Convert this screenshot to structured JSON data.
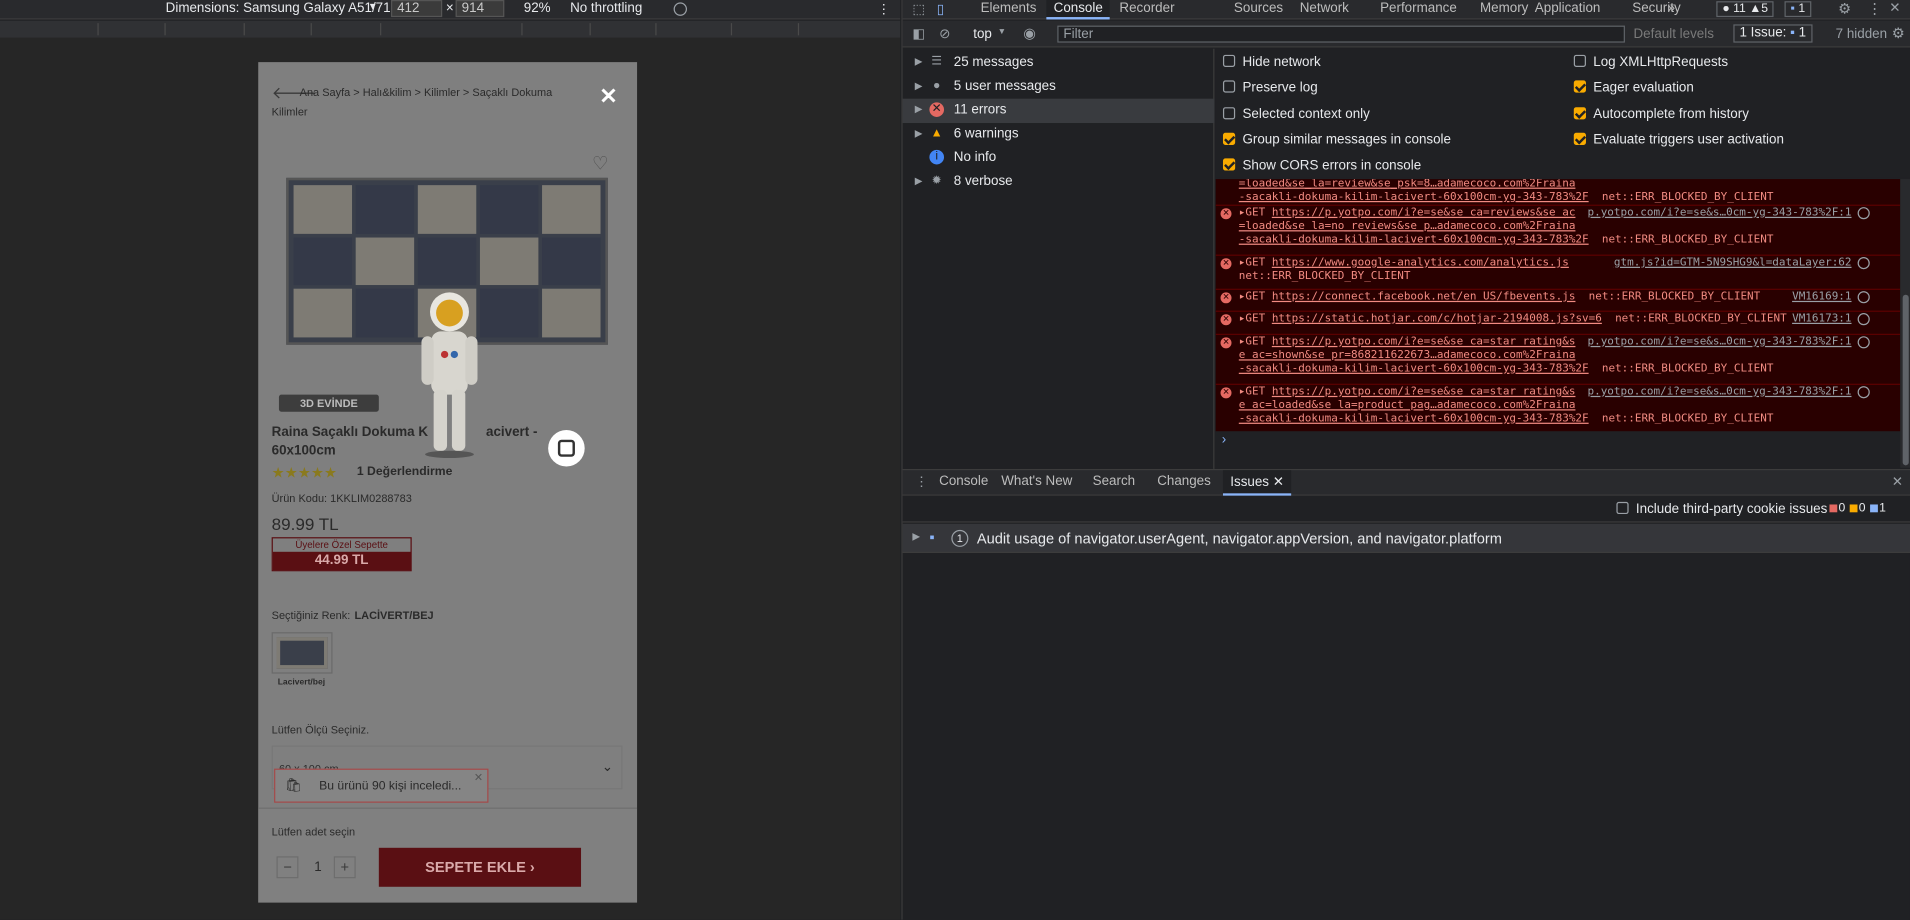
{
  "device_toolbar": {
    "dimensions_label": "Dimensions: Samsung Galaxy A51/71",
    "width_value": "412",
    "height_value": "914",
    "times": "×",
    "zoom": "92%",
    "throttling": "No throttling"
  },
  "page": {
    "breadcrumb": "Ana Sayfa > Halı&kilim > Kilimler > Saçaklı Dokuma",
    "breadcrumb_line2": "Kilimler",
    "badge_3d": "3D EVİNDE",
    "product_name_line1": "Raina Saçaklı Dokuma K",
    "product_name_line1b": "acivert -",
    "product_name_line2": "60x100cm",
    "stars": "★★★★★",
    "reviews": "1 Değerlendirme",
    "product_code": "Ürün Kodu: 1KKLIM0288783",
    "price": "89.99 TL",
    "member_label": "Üyelere Özel Sepette",
    "member_price": "44.99 TL",
    "color_label": "Seçtiğiniz Renk:",
    "color_value": "LACİVERT/BEJ",
    "swatch_label": "Lacivert/bej",
    "size_label": "Lütfen Ölçü Seçiniz.",
    "size_value": "60 x 100 cm",
    "toast": "Bu ürünü 90 kişi inceledi...",
    "qty_label": "Lütfen adet seçin",
    "qty_value": "1",
    "minus": "−",
    "plus": "+",
    "add_to_cart": "SEPETE EKLE ›",
    "close": "✕"
  },
  "devtools": {
    "tabs": [
      "Elements",
      "Console",
      "Recorder",
      "Sources",
      "Network",
      "Performance",
      "Memory",
      "Application",
      "Security"
    ],
    "more_tabs": "»",
    "error_count": "11",
    "warning_count": "5",
    "issue_count": "1",
    "context": "top",
    "filter_placeholder": "Filter",
    "default_levels": "Default levels",
    "issues_button": "1 Issue:",
    "issues_button_count": "1",
    "hidden": "7 hidden",
    "sidebar": [
      {
        "label": "25 messages",
        "icon": "list-icon"
      },
      {
        "label": "5 user messages",
        "icon": "user-icon"
      },
      {
        "label": "11 errors",
        "icon": "error-icon"
      },
      {
        "label": "6 warnings",
        "icon": "warning-icon"
      },
      {
        "label": "No info",
        "icon": "info-icon"
      },
      {
        "label": "8 verbose",
        "icon": "bug-icon"
      }
    ],
    "settings_left": [
      "Hide network",
      "Preserve log",
      "Selected context only",
      "Group similar messages in console",
      "Show CORS errors in console"
    ],
    "settings_left_checked": [
      false,
      false,
      false,
      true,
      true
    ],
    "settings_right": [
      "Log XMLHttpRequests",
      "Eager evaluation",
      "Autocomplete from history",
      "Evaluate triggers user activation"
    ],
    "settings_right_checked": [
      false,
      true,
      true,
      true
    ],
    "log": [
      {
        "l1": "=loaded&se_la=review&se_psk=8…adamecoco.com%2Fraina",
        "l2": "-sacakli-dokuma-kilim-lacivert-60x100cm-yg-343-783%2F",
        "err": "net::ERR_BLOCKED_BY_CLIENT",
        "src": ""
      },
      {
        "l1": "GET ",
        "url": "https://p.yotpo.com/i?e=se&se_ca=reviews&se_ac",
        "l1b": "=loaded&se_la=no_reviews&se_p…adamecoco.com%2Fraina",
        "l2": "-sacakli-dokuma-kilim-lacivert-60x100cm-yg-343-783%2F",
        "err": "net::ERR_BLOCKED_BY_CLIENT",
        "src": "p.yotpo.com/i?e=se&s…0cm-yg-343-783%2F:1"
      },
      {
        "l1": "GET ",
        "url": "https://www.google-analytics.com/analytics.js",
        "l2": "net::ERR_BLOCKED_BY_CLIENT",
        "src": "gtm.js?id=GTM-5N9SHG9&l=dataLayer:62"
      },
      {
        "l1": "GET ",
        "url": "https://connect.facebook.net/en_US/fbevents.js",
        "err": "net::ERR_BLOCKED_BY_CLIENT",
        "src": "VM16169:1"
      },
      {
        "l1": "GET ",
        "url": "https://static.hotjar.com/c/hotjar-2194008.js?sv=6",
        "err": "net::ERR_BLOCKED_BY_CLIENT",
        "src": "VM16173:1"
      },
      {
        "l1": "GET ",
        "url": "https://p.yotpo.com/i?e=se&se_ca=star_rating&s",
        "l1b": "e_ac=shown&se_pr=868211622673…adamecoco.com%2Fraina",
        "l2": "-sacakli-dokuma-kilim-lacivert-60x100cm-yg-343-783%2F",
        "err": "net::ERR_BLOCKED_BY_CLIENT",
        "src": "p.yotpo.com/i?e=se&s…0cm-yg-343-783%2F:1"
      },
      {
        "l1": "GET ",
        "url": "https://p.yotpo.com/i?e=se&se_ca=star_rating&s",
        "l1b": "e_ac=loaded&se_la=product_pag…adamecoco.com%2Fraina",
        "l2": "-sacakli-dokuma-kilim-lacivert-60x100cm-yg-343-783%2F",
        "err": "net::ERR_BLOCKED_BY_CLIENT",
        "src": "p.yotpo.com/i?e=se&s…0cm-yg-343-783%2F:1"
      }
    ],
    "prompt": "›",
    "drawer_tabs": [
      "Console",
      "What's New",
      "Search",
      "Changes",
      "Issues"
    ],
    "third_party": "Include third-party cookie issues",
    "issue_counts": [
      "0",
      "0",
      "1"
    ],
    "issue_text": "Audit usage of navigator.userAgent, navigator.appVersion, and navigator.platform",
    "issue_num": "1"
  },
  "colors": {
    "accent": "#8ab4f8",
    "error": "#e46962",
    "warning": "#f9ab00"
  }
}
